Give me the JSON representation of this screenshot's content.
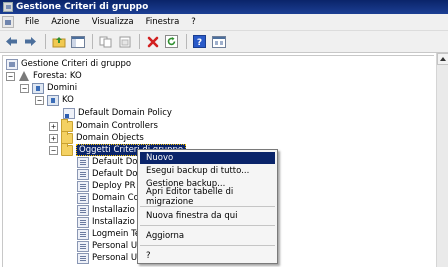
{
  "window": {
    "title": "Gestione Criteri di gruppo"
  },
  "menu": {
    "items": [
      "File",
      "Azione",
      "Visualizza",
      "Finestra",
      "?"
    ]
  },
  "toolbar": {
    "icons": [
      "back-arrow-icon",
      "forward-arrow-icon",
      "folder-up-icon",
      "show-tree-icon",
      "copy-icon",
      "paste-icon",
      "delete-icon",
      "refresh-icon",
      "help-icon",
      "properties-icon"
    ],
    "colors": {
      "delete": "#d21f1f",
      "refresh": "#2f8f2f",
      "help": "#2a5ac8",
      "arrows": "#4c6f9c"
    }
  },
  "tree": {
    "root": "Gestione Criteri di gruppo",
    "forest": "Foresta: KO",
    "domini": "Domini",
    "domain": "KO",
    "default_domain_policy": "Default Domain Policy",
    "domain_controllers": "Domain Controllers",
    "domain_objects": "Domain Objects",
    "gpo_folder": "Oggetti Criteri di gruppo",
    "gpos": [
      "Default Do",
      "Default Do",
      "Deploy PR",
      "Domain Co",
      "Installazio",
      "Installazio",
      "Logmein Te",
      "Personal U",
      "Personal U"
    ],
    "expander_open": "−",
    "expander_closed": "+"
  },
  "context_menu": {
    "items": [
      {
        "label": "Nuovo",
        "highlighted": true
      },
      {
        "label": "Esegui backup di tutto..."
      },
      {
        "label": "Gestione backup..."
      },
      {
        "label": "Apri Editor tabelle di migrazione"
      },
      {
        "label": "Nuova finestra da qui"
      },
      {
        "label": "Aggiorna"
      },
      {
        "label": "?"
      }
    ]
  }
}
